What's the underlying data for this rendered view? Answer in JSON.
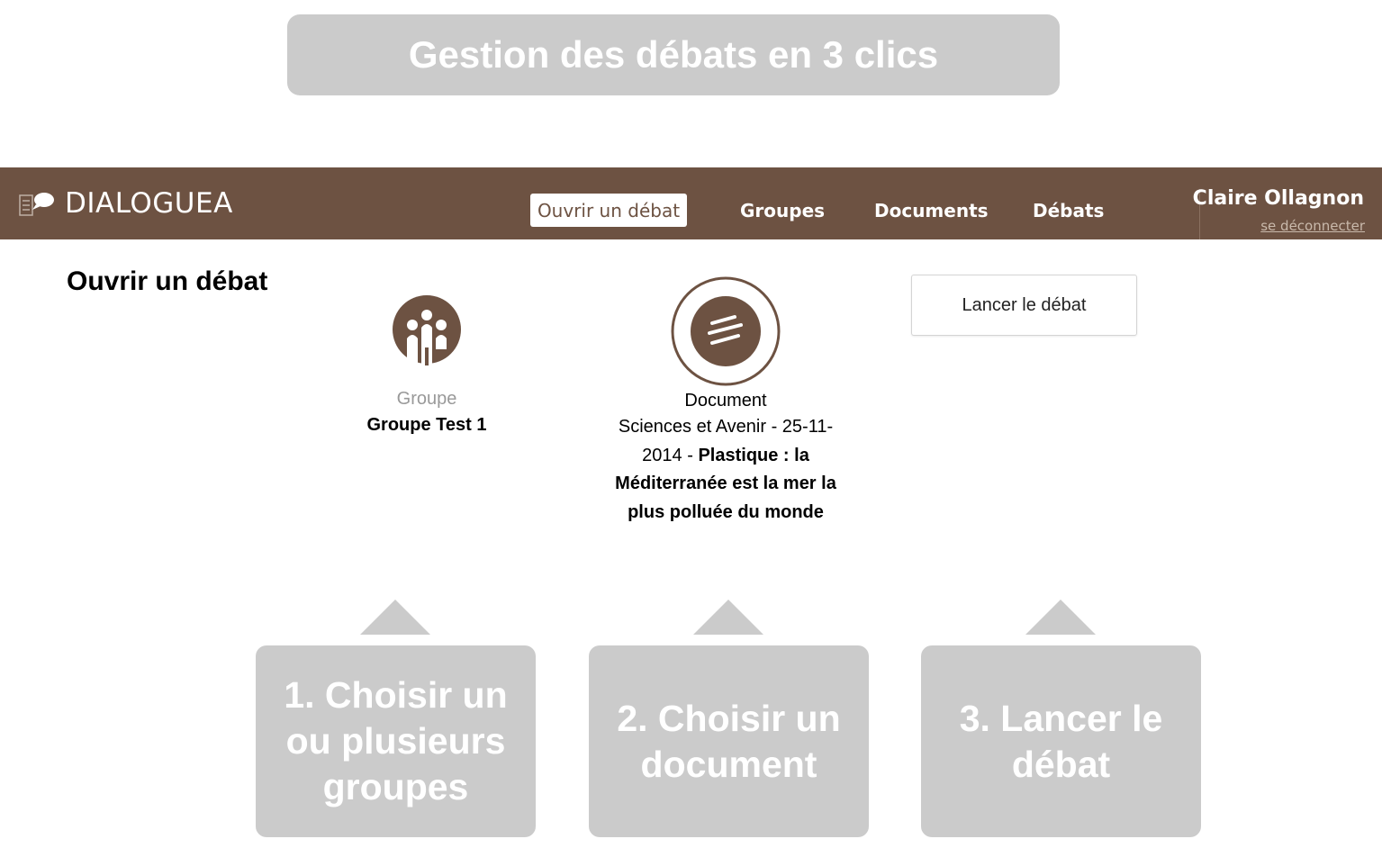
{
  "banner": {
    "title": "Gestion des débats en 3 clics"
  },
  "navbar": {
    "brand": "DIALOGUEA",
    "items": [
      {
        "label": "Ouvrir un débat",
        "active": true
      },
      {
        "label": "Groupes",
        "active": false
      },
      {
        "label": "Documents",
        "active": false
      },
      {
        "label": "Débats",
        "active": false
      }
    ],
    "user_name": "Claire Ollagnon",
    "logout_label": "se déconnecter",
    "bg_color": "#6d5242"
  },
  "main": {
    "title": "Ouvrir un débat",
    "group": {
      "label": "Groupe",
      "value": "Groupe Test 1",
      "icon": "group-icon"
    },
    "document": {
      "label": "Document",
      "source": "Sciences et Avenir - 25-11-2014 -",
      "title": "Plastique : la Méditerranée est la mer la plus polluée du monde",
      "icon": "document-icon"
    },
    "launch_button": "Lancer le débat"
  },
  "steps": [
    {
      "label": "1. Choisir un ou plusieurs groupes"
    },
    {
      "label": "2. Choisir un document"
    },
    {
      "label": "3. Lancer le débat"
    }
  ]
}
